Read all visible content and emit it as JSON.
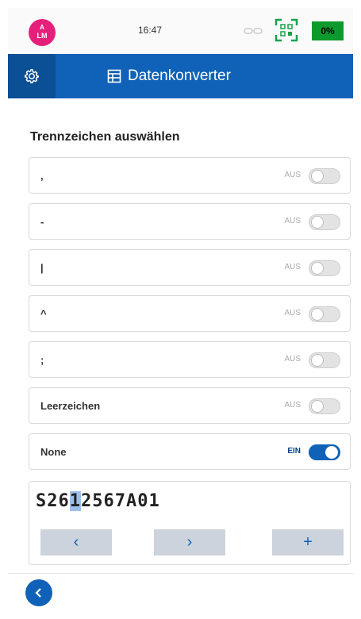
{
  "status_bar": {
    "avatar_line1": "A",
    "avatar_line2": "LM",
    "time": "16:47",
    "battery_label": "0%",
    "colors": {
      "avatar": "#e6207a",
      "battery": "#0c9a2c"
    }
  },
  "header": {
    "title": "Datenkonverter",
    "settings_icon": "gear-icon",
    "title_icon": "converter-icon",
    "color": "#0f62b7"
  },
  "section": {
    "title": "Trennzeichen auswählen"
  },
  "separators": [
    {
      "label": ",",
      "state": "AUS",
      "enabled": false
    },
    {
      "label": "-",
      "state": "AUS",
      "enabled": false
    },
    {
      "label": "|",
      "state": "AUS",
      "enabled": false
    },
    {
      "label": "^",
      "state": "AUS",
      "enabled": false
    },
    {
      "label": ";",
      "state": "AUS",
      "enabled": false
    },
    {
      "label": "Leerzeichen",
      "state": "AUS",
      "enabled": false
    },
    {
      "label": "None",
      "state": "EIN",
      "enabled": true
    }
  ],
  "preview": {
    "before": "S26",
    "highlight": "1",
    "after": "2567A01",
    "buttons": {
      "prev": "‹",
      "next": "›",
      "add": "+"
    }
  },
  "footer": {
    "back_icon": "chevron-left-icon"
  }
}
